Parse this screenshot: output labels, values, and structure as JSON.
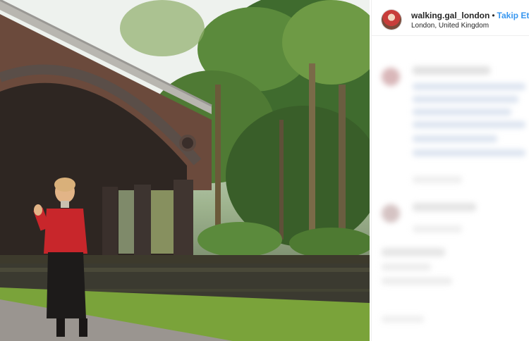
{
  "post": {
    "username": "walking.gal_london",
    "separator": "•",
    "follow_label": "Takip Et",
    "location": "London, United Kingdom"
  },
  "colors": {
    "accent": "#3897f0",
    "text": "#262626",
    "divider": "#efefef"
  },
  "icons": {
    "avatar": "profile-photo"
  }
}
